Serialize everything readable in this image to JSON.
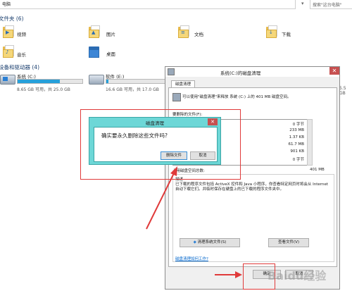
{
  "address": {
    "path": "电脑",
    "search_placeholder": "搜索\"这台电脑\""
  },
  "folders_section": {
    "title": "文件夹 (6)"
  },
  "folders": [
    {
      "label": "视频",
      "icon": "video-folder-icon"
    },
    {
      "label": "图片",
      "icon": "pictures-folder-icon"
    },
    {
      "label": "文档",
      "icon": "documents-folder-icon"
    },
    {
      "label": "下载",
      "icon": "downloads-folder-icon"
    },
    {
      "label": "音乐",
      "icon": "music-folder-icon"
    },
    {
      "label": "桌面",
      "icon": "desktop-folder-icon"
    }
  ],
  "drives_section": {
    "title": "设备和驱动器 (4)"
  },
  "drives": [
    {
      "label": "系统 (C:)",
      "free": "8.65 GB 可用，共 25.0 GB",
      "usage": 0.65
    },
    {
      "label": "软件 (E:)",
      "free": "16.6 GB 可用，共 17.0 GB",
      "usage": 0.03
    },
    {
      "free_partial": "5.5 GB"
    }
  ],
  "cleanup_window": {
    "title": "系统(C:)的磁盘清理",
    "tab": "磁盘清理",
    "intro": "可以使用\"磁盘清理\"来释放 系统 (C:) 上的 401 MB 磁盘空间。",
    "list_label": "要删除的文件(F):",
    "list_sizes": [
      "0 字节",
      "233 MB",
      "1.37 KB",
      "61.7 MB",
      "901 KB",
      "0 字节"
    ],
    "total_label": "占用磁盘空间总数:",
    "total_value": "401 MB",
    "description_label": "描述",
    "description": "已下载的程序文件包括 ActiveX 控件和 Java 小程序，你查看特定网页时将会从 Internet 自动下载它们。并临时保存在硬盘上的已下载的程序文件夹中。",
    "clean_system_button": "清理系统文件(S)",
    "view_files_button": "查看文件(V)",
    "how_link": "磁盘清理如何工作?",
    "ok_button": "确定",
    "cancel_button": "取消"
  },
  "confirm_dialog": {
    "title": "磁盘清理",
    "message": "确实要永久删除这些文件吗?",
    "delete_button": "删除文件",
    "cancel_button": "取消"
  },
  "watermark": "Baidu经验",
  "colors": {
    "highlight": "#e03a3a",
    "dialog_frame": "#6dd7d7",
    "accent": "#26a0da"
  }
}
